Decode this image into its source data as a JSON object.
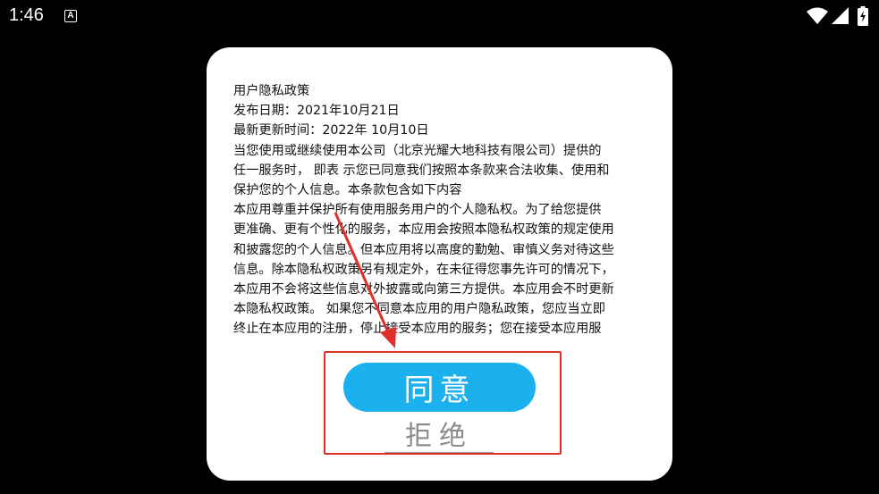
{
  "status_bar": {
    "time": "1:46",
    "notification_icon_letter": "A",
    "icons": [
      "wifi-icon",
      "signal-icon",
      "battery-charging-icon"
    ]
  },
  "dialog": {
    "lines": [
      "用户隐私政策",
      " 发布日期：2021年10月21日",
      " 最新更新时间：2022年 10月10日",
      " 当您使用或继续使用本公司（北京光耀大地科技有限公司）提供的",
      "任一服务时， 即表 示您已同意我们按照本条款来合法收集、使用和",
      "保护您的个人信息。本条款包含如下内容",
      " 本应用尊重并保护所有使用服务用户的个人隐私权。为了给您提供",
      "更准确、更有个性化的服务，本应用会按照本隐私权政策的规定使用",
      "和披露您的个人信息。但本应用将以高度的勤勉、审慎义务对待这些",
      "信息。除本隐私权政策另有规定外，在未征得您事先许可的情况下，",
      "本应用不会将这些信息对外披露或向第三方提供。本应用会不时更新",
      "本隐私权政策。 如果您不同意本应用的用户隐私政策，您应当立即",
      "终止在本应用的注册，停止接受本应用的服务；您在接受本应用服"
    ],
    "agree_label": "同意",
    "decline_label": "拒绝"
  },
  "colors": {
    "agree_button": "#1ab1ee",
    "highlight": "#e0302c",
    "background": "#000000"
  }
}
